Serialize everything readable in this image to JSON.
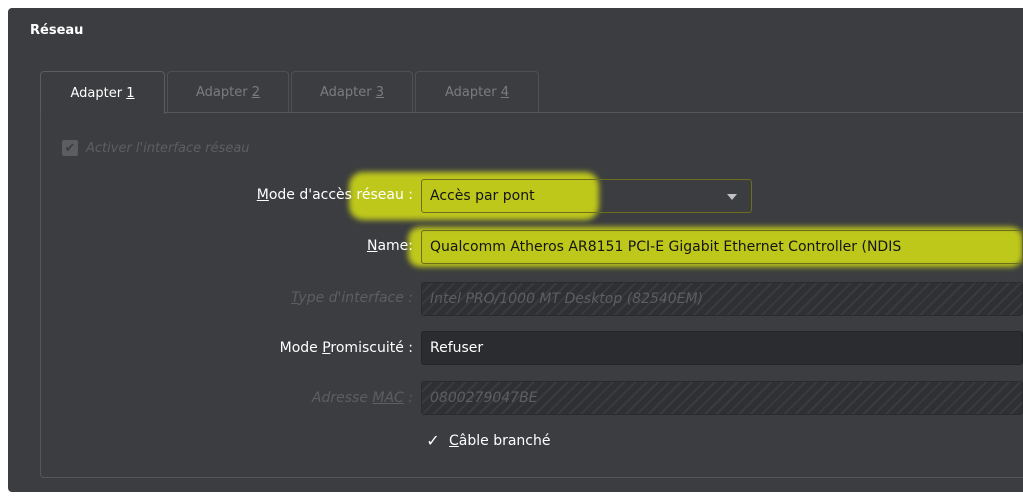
{
  "section": {
    "title": "Réseau"
  },
  "tabs": [
    {
      "label": "Adapter ",
      "mnemonic": "1",
      "active": true
    },
    {
      "label": "Adapter ",
      "mnemonic": "2",
      "active": false
    },
    {
      "label": "Adapter ",
      "mnemonic": "3",
      "active": false
    },
    {
      "label": "Adapter ",
      "mnemonic": "4",
      "active": false
    }
  ],
  "enable_interface": {
    "label": "Activer l'interface réseau",
    "checked": true,
    "disabled": true
  },
  "access_mode": {
    "mnemonic": "M",
    "label_rest": "ode d'accès réseau :",
    "value": "Accès par pont"
  },
  "name": {
    "mnemonic": "N",
    "label_rest": "ame:",
    "value": "Qualcomm Atheros AR8151 PCI-E Gigabit Ethernet Controller (NDIS"
  },
  "interface_type": {
    "mnemonic": "T",
    "label_rest": "ype d'interface :",
    "value": "Intel PRO/1000 MT Desktop (82540EM)"
  },
  "promiscuous": {
    "label_pre": "Mode ",
    "mnemonic": "P",
    "label_rest": "romiscuité :",
    "value": "Refuser"
  },
  "mac": {
    "label_pre": "Adresse ",
    "mnemonic": "MAC",
    "label_rest": " :",
    "value": "0800279047BE"
  },
  "cable": {
    "mnemonic": "C",
    "label_rest": "âble branché",
    "checked": true
  },
  "colors": {
    "highlight": "#c8d214",
    "panel": "#3b3d40"
  }
}
